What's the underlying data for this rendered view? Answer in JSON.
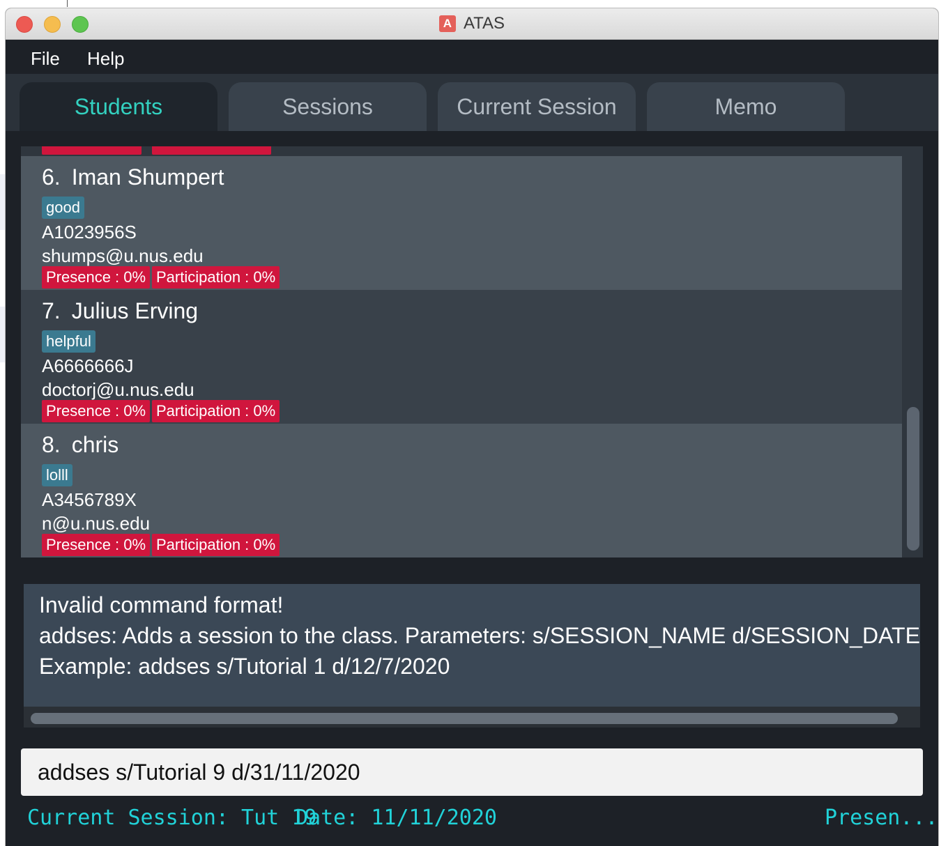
{
  "window": {
    "title": "ATAS",
    "app_icon_letter": "A"
  },
  "menu": {
    "file": "File",
    "help": "Help"
  },
  "tabs": [
    {
      "label": "Students",
      "selected": true
    },
    {
      "label": "Sessions",
      "selected": false
    },
    {
      "label": "Current Session",
      "selected": false
    },
    {
      "label": "Memo",
      "selected": false
    }
  ],
  "students": [
    {
      "index": "6.",
      "name": "Iman Shumpert",
      "tag": "good",
      "id": "A1023956S",
      "email": "shumps@u.nus.edu",
      "presence": "Presence : 0%",
      "participation": "Participation : 0%"
    },
    {
      "index": "7.",
      "name": "Julius Erving",
      "tag": "helpful",
      "id": "A6666666J",
      "email": "doctorj@u.nus.edu",
      "presence": "Presence : 0%",
      "participation": "Participation : 0%"
    },
    {
      "index": "8.",
      "name": "chris",
      "tag": "lolll",
      "id": "A3456789X",
      "email": "n@u.nus.edu",
      "presence": "Presence : 0%",
      "participation": "Participation : 0%"
    }
  ],
  "result": {
    "line1": "Invalid command format!",
    "line2": "addses: Adds a session to the class. Parameters: s/SESSION_NAME d/SESSION_DATE",
    "line3": "Example: addses s/Tutorial 1 d/12/7/2020"
  },
  "command": {
    "value": "addses s/Tutorial 9 d/31/11/2020"
  },
  "status": {
    "session": "Current Session: Tut 19",
    "date": "Date: 11/11/2020",
    "presence": "Presen..."
  },
  "colors": {
    "accent": "#33d1c0",
    "badge_red": "#d0163d",
    "tag_blue": "#3b7a90",
    "status_cyan": "#21d2d8"
  }
}
